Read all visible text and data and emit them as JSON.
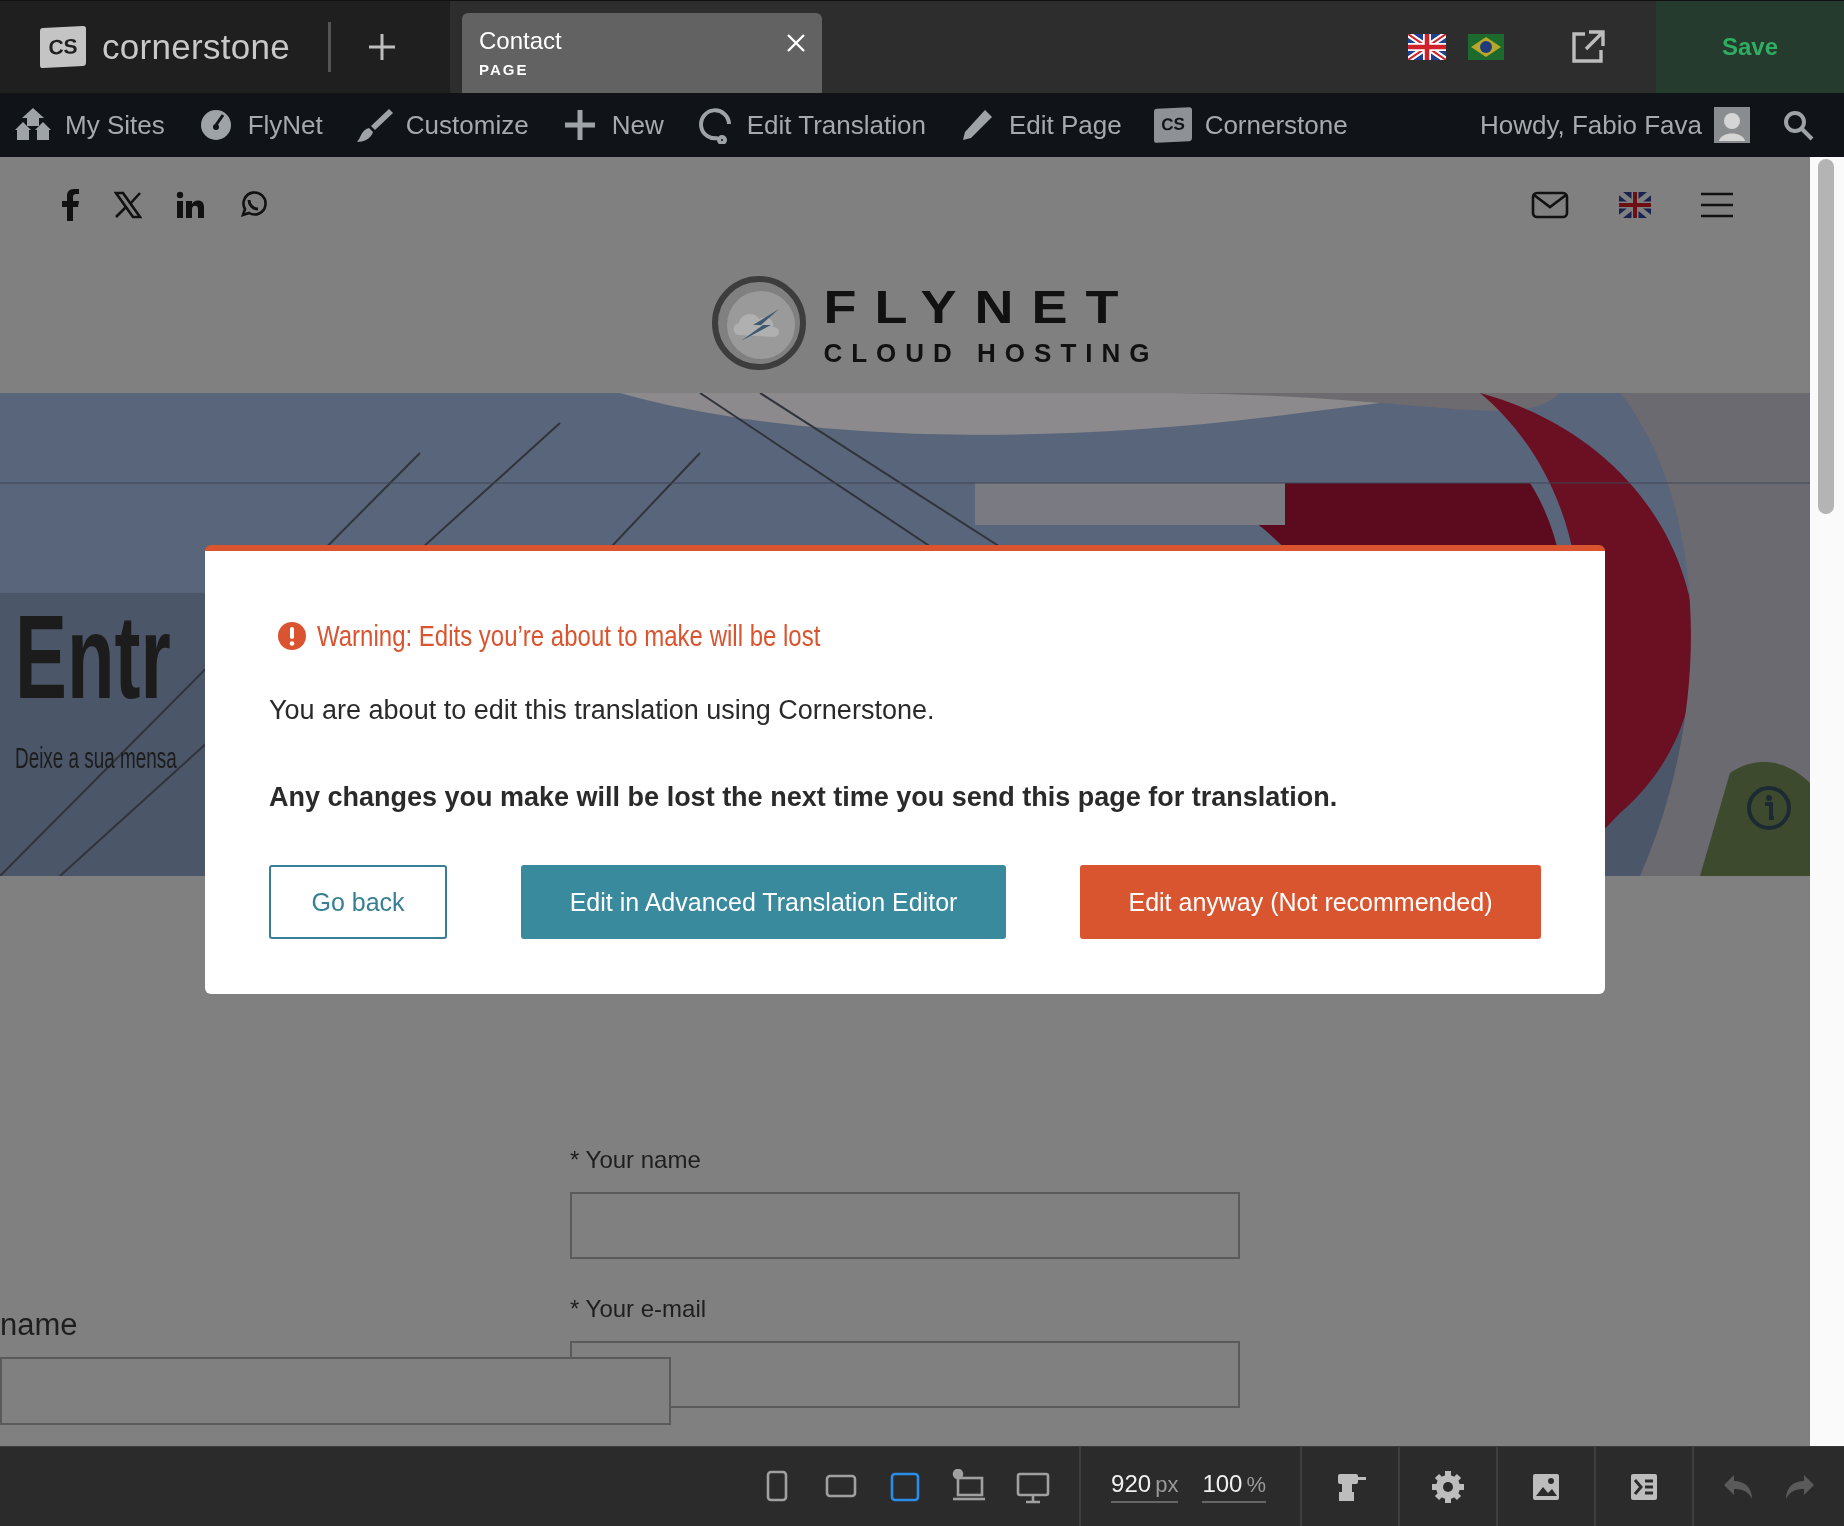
{
  "top_bar": {
    "logo": {
      "badge": "CS",
      "name": "cornerstone"
    },
    "document_tab": {
      "title": "Contact",
      "subtitle": "PAGE"
    },
    "save_button": {
      "label": "Save"
    }
  },
  "admin_bar": {
    "items": [
      {
        "label": "My Sites"
      },
      {
        "label": "FlyNet"
      },
      {
        "label": "Customize"
      },
      {
        "label": "New"
      },
      {
        "label": "Edit Translation"
      },
      {
        "label": "Edit Page"
      },
      {
        "label": "Cornerstone",
        "badge": "CS"
      }
    ],
    "greeting": "Howdy, Fabio Fava"
  },
  "site_logo": {
    "name": "FLYNET",
    "tagline": "CLOUD HOSTING"
  },
  "hero": {
    "heading": "Entr",
    "subheading": "Deixe a sua mensa"
  },
  "form": {
    "fields": [
      {
        "label": "* Your name"
      },
      {
        "label": "* Your e-mail"
      }
    ],
    "stray_field": {
      "label": "name"
    }
  },
  "modal": {
    "warning": "Warning: Edits you’re about to make will be lost",
    "message": "You are about to edit this translation using Cornerstone.",
    "emphasis": "Any changes you make will be lost the next time you send this page for translation.",
    "buttons": [
      {
        "label": "Go back",
        "kind": "outline"
      },
      {
        "label": "Edit in Advanced Translation Editor",
        "kind": "primary"
      },
      {
        "label": "Edit anyway (Not recommended)",
        "kind": "danger"
      }
    ]
  },
  "bottom_bar": {
    "devices": [
      {
        "selected": false
      },
      {
        "selected": false
      },
      {
        "selected": true
      },
      {
        "selected": false
      },
      {
        "selected": false
      }
    ],
    "width": {
      "value": "920",
      "unit": "px"
    },
    "zoom": {
      "value": "100",
      "unit": "%"
    }
  }
}
